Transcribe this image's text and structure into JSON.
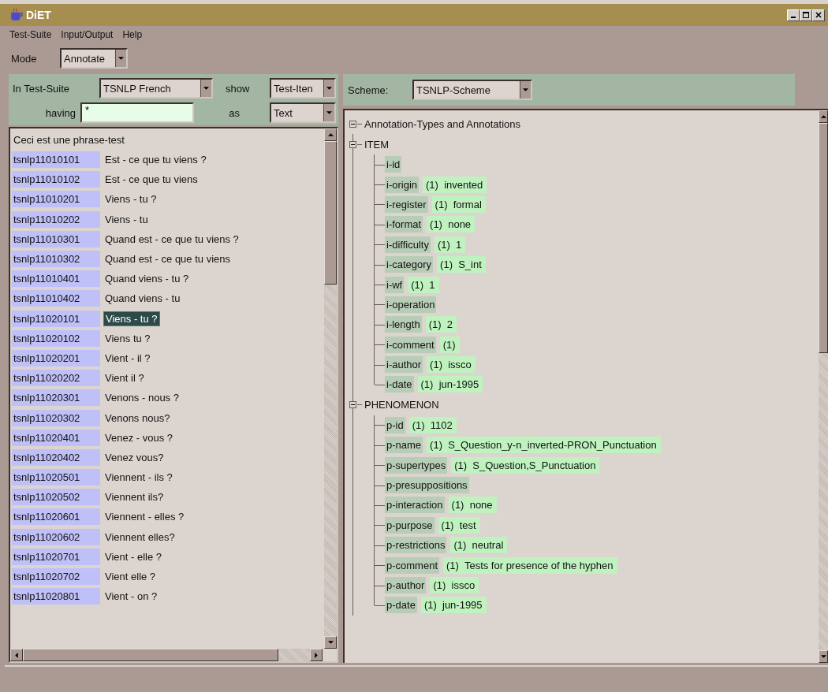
{
  "window": {
    "title": "DiET"
  },
  "menu": [
    "Test-Suite",
    "Input/Output",
    "Help"
  ],
  "mode": {
    "label": "Mode",
    "value": "Annotate"
  },
  "filter": {
    "suite_label": "In Test-Suite",
    "suite": "TSNLP French",
    "show_label": "show",
    "show": "Test-Iten",
    "having_label": "having",
    "having": "*",
    "as_label": "as",
    "as": "Text"
  },
  "list": {
    "header": "Ceci est une phrase-test",
    "items": [
      {
        "id": "tsnlp11010101",
        "text": "Est - ce que tu viens ?",
        "selected": false
      },
      {
        "id": "tsnlp11010102",
        "text": "Est - ce que tu viens",
        "selected": false
      },
      {
        "id": "tsnlp11010201",
        "text": "Viens - tu ?",
        "selected": false
      },
      {
        "id": "tsnlp11010202",
        "text": "Viens - tu",
        "selected": false
      },
      {
        "id": "tsnlp11010301",
        "text": "Quand est - ce que tu viens ?",
        "selected": false
      },
      {
        "id": "tsnlp11010302",
        "text": "Quand est - ce que tu viens",
        "selected": false
      },
      {
        "id": "tsnlp11010401",
        "text": "Quand viens - tu ?",
        "selected": false
      },
      {
        "id": "tsnlp11010402",
        "text": "Quand viens - tu",
        "selected": false
      },
      {
        "id": "tsnlp11020101",
        "text": "Viens - tu ?",
        "selected": true
      },
      {
        "id": "tsnlp11020102",
        "text": "Viens tu ?",
        "selected": false
      },
      {
        "id": "tsnlp11020201",
        "text": "Vient - il ?",
        "selected": false
      },
      {
        "id": "tsnlp11020202",
        "text": "Vient il ?",
        "selected": false
      },
      {
        "id": "tsnlp11020301",
        "text": "Venons - nous ?",
        "selected": false
      },
      {
        "id": "tsnlp11020302",
        "text": "Venons nous?",
        "selected": false
      },
      {
        "id": "tsnlp11020401",
        "text": "Venez - vous ?",
        "selected": false
      },
      {
        "id": "tsnlp11020402",
        "text": "Venez vous?",
        "selected": false
      },
      {
        "id": "tsnlp11020501",
        "text": "Viennent - ils ?",
        "selected": false
      },
      {
        "id": "tsnlp11020502",
        "text": "Viennent ils?",
        "selected": false
      },
      {
        "id": "tsnlp11020601",
        "text": "Viennent - elles ?",
        "selected": false
      },
      {
        "id": "tsnlp11020602",
        "text": "Viennent elles?",
        "selected": false
      },
      {
        "id": "tsnlp11020701",
        "text": "Vient - elle ?",
        "selected": false
      },
      {
        "id": "tsnlp11020702",
        "text": "Vient elle ?",
        "selected": false
      },
      {
        "id": "tsnlp11020801",
        "text": "Vient - on ?",
        "selected": false
      }
    ]
  },
  "scheme": {
    "label": "Scheme:",
    "value": "TSNLP-Scheme"
  },
  "tree": {
    "label": "Annotation-Types and Annotations",
    "expanded": true,
    "children": [
      {
        "label": "ITEM",
        "expanded": true,
        "children": [
          {
            "name": "i-id"
          },
          {
            "name": "i-origin",
            "value": "(1)  invented"
          },
          {
            "name": "i-register",
            "value": "(1)  formal"
          },
          {
            "name": "i-format",
            "value": "(1)  none"
          },
          {
            "name": "i-difficulty",
            "value": "(1)  1"
          },
          {
            "name": "i-category",
            "value": "(1)  S_int"
          },
          {
            "name": "i-wf",
            "value": "(1)  1"
          },
          {
            "name": "i-operation"
          },
          {
            "name": "i-length",
            "value": "(1)  2"
          },
          {
            "name": "i-comment",
            "value": "(1)"
          },
          {
            "name": "i-author",
            "value": "(1)  issco"
          },
          {
            "name": "i-date",
            "value": "(1)  jun-1995"
          }
        ]
      },
      {
        "label": "PHENOMENON",
        "expanded": true,
        "children": [
          {
            "name": "p-id",
            "value": "(1)  1102"
          },
          {
            "name": "p-name",
            "value": "(1)  S_Question_y-n_inverted-PRON_Punctuation"
          },
          {
            "name": "p-supertypes",
            "value": "(1)  S_Question,S_Punctuation"
          },
          {
            "name": "p-presuppositions"
          },
          {
            "name": "p-interaction",
            "value": "(1)  none"
          },
          {
            "name": "p-purpose",
            "value": "(1)  test"
          },
          {
            "name": "p-restrictions",
            "value": "(1)  neutral"
          },
          {
            "name": "p-comment",
            "value": "(1)  Tests for presence of the hyphen"
          },
          {
            "name": "p-author",
            "value": "(1)  issco"
          },
          {
            "name": "p-date",
            "value": "(1)  jun-1995"
          }
        ]
      }
    ]
  }
}
